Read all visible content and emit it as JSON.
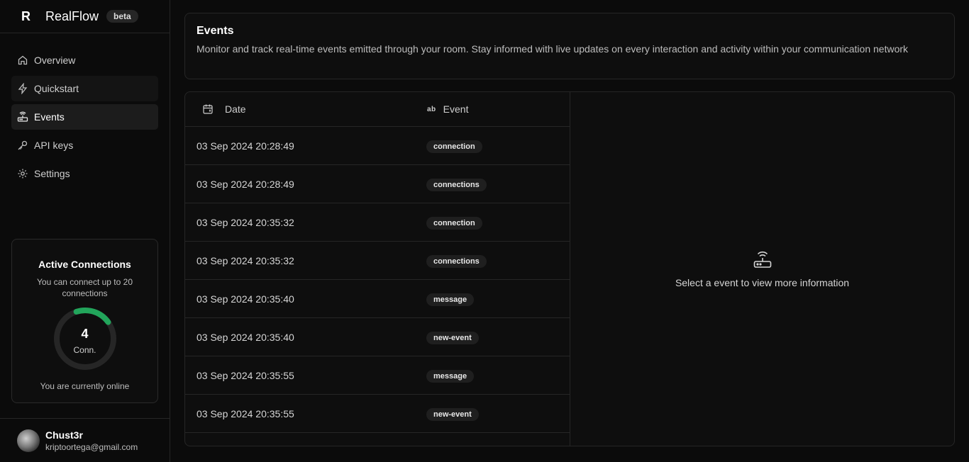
{
  "brand": {
    "logo": "R",
    "name": "RealFlow",
    "badge": "beta"
  },
  "nav": {
    "items": [
      {
        "label": "Overview",
        "icon": "home-icon"
      },
      {
        "label": "Quickstart",
        "icon": "bolt-icon"
      },
      {
        "label": "Events",
        "icon": "router-icon"
      },
      {
        "label": "API keys",
        "icon": "key-icon"
      },
      {
        "label": "Settings",
        "icon": "gear-icon"
      }
    ],
    "active": "Events"
  },
  "connections": {
    "title": "Active Connections",
    "description": "You can connect up to 20 connections",
    "value": "4",
    "unit": "Conn.",
    "max": 20,
    "status": "You are currently online",
    "accent": "#22a55b"
  },
  "user": {
    "name": "Chust3r",
    "email": "kriptoortega@gmail.com"
  },
  "header": {
    "title": "Events",
    "description": "Monitor and track real-time events emitted through your room. Stay informed with live updates on every interaction and activity within your communication network"
  },
  "table": {
    "columns": {
      "date": "Date",
      "event_icon_text": "ab",
      "event": "Event"
    },
    "rows": [
      {
        "date": "03 Sep 2024 20:28:49",
        "event": "connection"
      },
      {
        "date": "03 Sep 2024 20:28:49",
        "event": "connections"
      },
      {
        "date": "03 Sep 2024 20:35:32",
        "event": "connection"
      },
      {
        "date": "03 Sep 2024 20:35:32",
        "event": "connections"
      },
      {
        "date": "03 Sep 2024 20:35:40",
        "event": "message"
      },
      {
        "date": "03 Sep 2024 20:35:40",
        "event": "new-event"
      },
      {
        "date": "03 Sep 2024 20:35:55",
        "event": "message"
      },
      {
        "date": "03 Sep 2024 20:35:55",
        "event": "new-event"
      }
    ]
  },
  "detail": {
    "placeholder": "Select a event to view more information",
    "icon": "router-icon"
  }
}
